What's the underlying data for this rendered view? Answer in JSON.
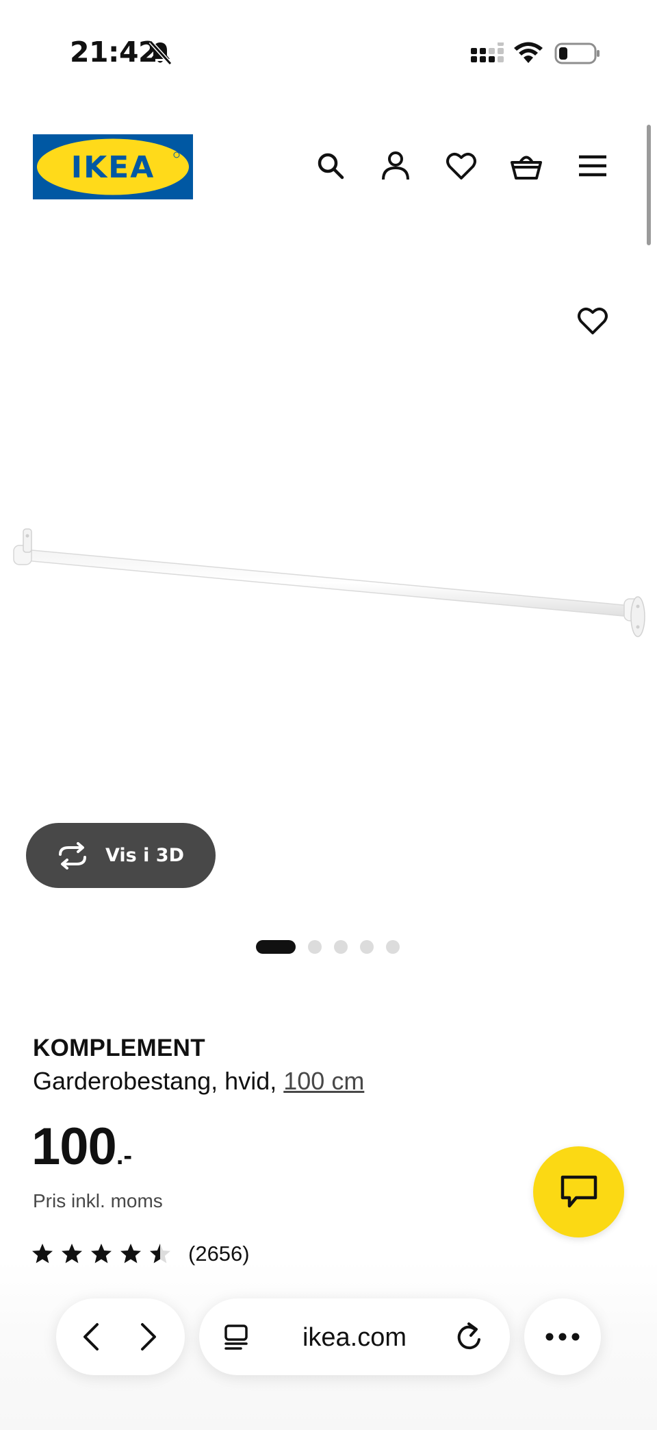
{
  "status_bar": {
    "time": "21:42",
    "icons": [
      "bell-muted-icon",
      "cellular-signal-icon",
      "wifi-icon",
      "battery-low-icon"
    ]
  },
  "header": {
    "logo_text": "IKEA",
    "icons": [
      "search-icon",
      "account-icon",
      "heart-icon",
      "basket-icon",
      "hamburger-menu-icon"
    ],
    "brand_colors": {
      "blue": "#0058a3",
      "yellow": "#ffda1a"
    }
  },
  "product_gallery": {
    "favorite_icon": "heart-icon",
    "view_3d_label": "Vis i 3D",
    "view_3d_icon": "rotate-3d-icon",
    "image_count": 5,
    "active_image_index": 0
  },
  "product": {
    "name": "KOMPLEMENT",
    "description": "Garderobestang, hvid,",
    "size_link": "100 cm",
    "price_amount": "100",
    "price_suffix": ".-",
    "price_note": "Pris inkl. moms",
    "rating": 4.5,
    "rating_max": 5,
    "review_count": "(2656)"
  },
  "chat": {
    "icon": "chat-bubble-icon",
    "color": "#fbd914"
  },
  "browser_toolbar": {
    "url": "ikea.com",
    "icons": [
      "back-arrow-icon",
      "forward-arrow-icon",
      "reader-mode-icon",
      "reload-icon",
      "more-dots-icon"
    ]
  }
}
